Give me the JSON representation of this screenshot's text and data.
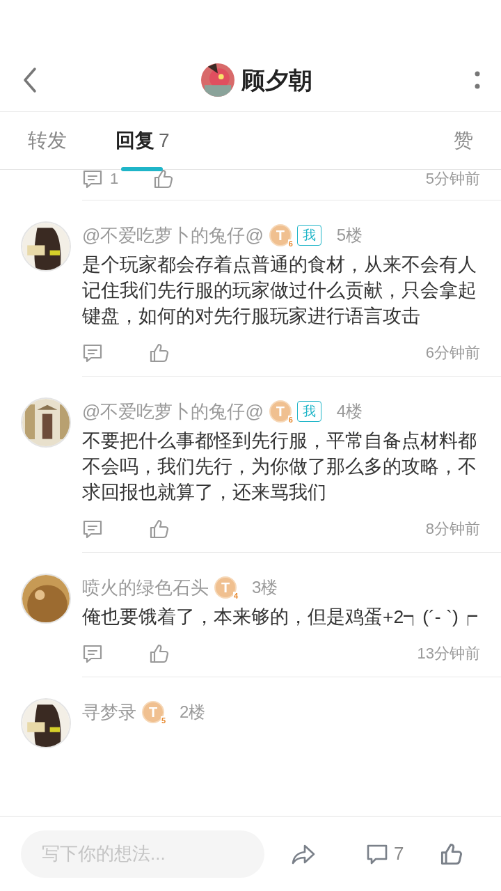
{
  "header": {
    "title": "顾夕朝"
  },
  "tabs": [
    {
      "label": "转发",
      "selected": false
    },
    {
      "label": "回复",
      "count": "7",
      "selected": true
    },
    {
      "label": "赞",
      "selected": false
    }
  ],
  "comments": [
    {
      "kind": "tail",
      "reply_count": "1",
      "time": "5分钟前"
    },
    {
      "kind": "full",
      "author": "@不爱吃萝卜的兔仔@",
      "badge": {
        "letter": "T",
        "grade": "6"
      },
      "me_tag": "我",
      "floor": "5楼",
      "text": "是个玩家都会存着点普通的食材，从来不会有人记住我们先行服的玩家做过什么贡献，只会拿起键盘，如何的对先行服玩家进行语言攻击",
      "time": "6分钟前"
    },
    {
      "kind": "full",
      "author": "@不爱吃萝卜的兔仔@",
      "badge": {
        "letter": "T",
        "grade": "6"
      },
      "me_tag": "我",
      "floor": "4楼",
      "text": "不要把什么事都怪到先行服，平常自备点材料都不会吗，我们先行，为你做了那么多的攻略，不求回报也就算了，还来骂我们",
      "time": "8分钟前"
    },
    {
      "kind": "full",
      "author": "喷火的绿色石头",
      "badge": {
        "letter": "T",
        "grade": "4"
      },
      "floor": "3楼",
      "text": "俺也要饿着了，本来够的，但是鸡蛋+2┑(´- `)┍",
      "time": "13分钟前"
    },
    {
      "kind": "head",
      "author": "寻梦录",
      "badge": {
        "letter": "T",
        "grade": "5"
      },
      "floor": "2楼"
    }
  ],
  "bottom_bar": {
    "placeholder": "写下你的想法...",
    "comment_count": "7"
  }
}
